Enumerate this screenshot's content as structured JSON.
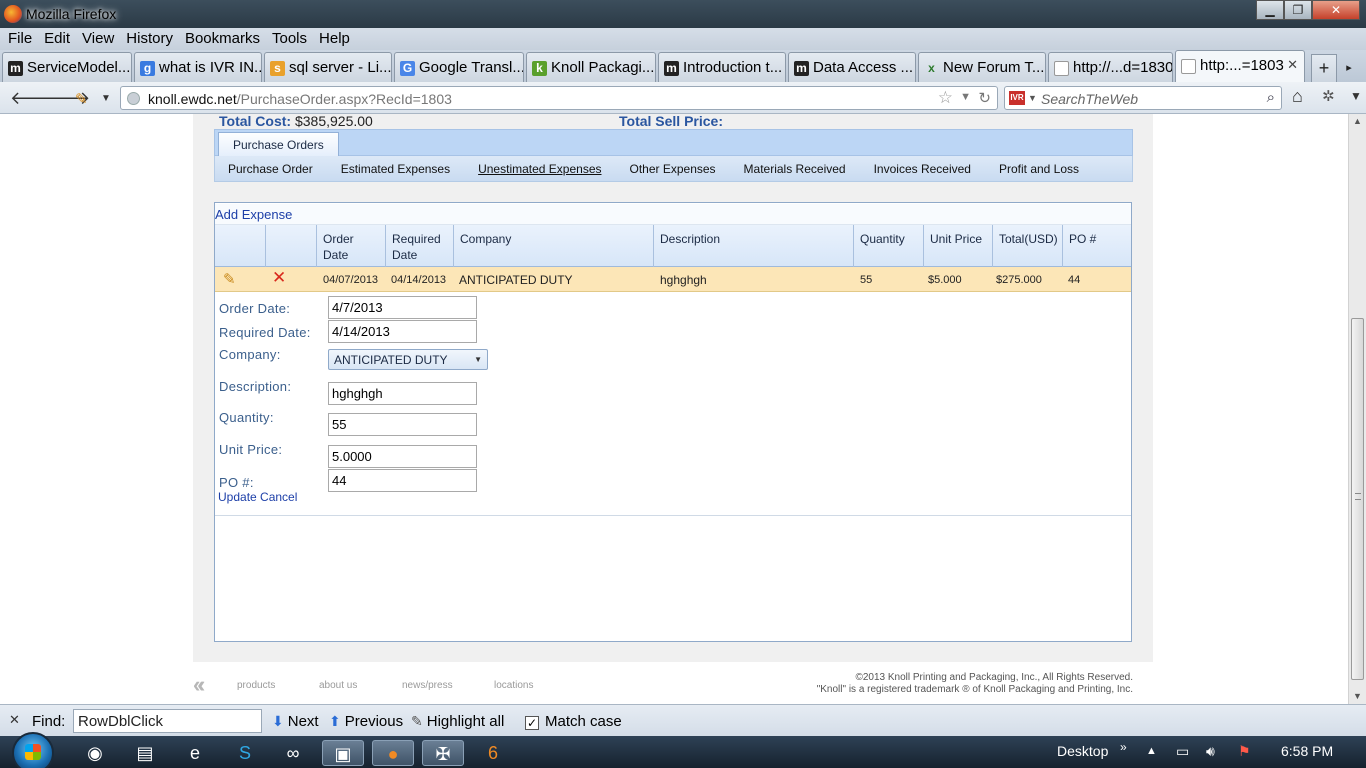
{
  "window": {
    "title": "Mozilla Firefox",
    "minimize": "▁",
    "restore": "❐",
    "close": "✕"
  },
  "menu": [
    "File",
    "Edit",
    "View",
    "History",
    "Bookmarks",
    "Tools",
    "Help"
  ],
  "tabs": [
    {
      "icon": "m",
      "label": "ServiceModel..."
    },
    {
      "icon": "g",
      "label": "what is IVR IN..."
    },
    {
      "icon": "s",
      "label": "sql server - Li..."
    },
    {
      "icon": "G",
      "label": "Google Transl..."
    },
    {
      "icon": "k",
      "label": "Knoll Packagi..."
    },
    {
      "icon": "m",
      "label": "Introduction t..."
    },
    {
      "icon": "m",
      "label": "Data Access ..."
    },
    {
      "icon": "x",
      "label": "New Forum T..."
    },
    {
      "icon": "",
      "label": "http://...d=1830"
    },
    {
      "icon": "",
      "label": "http:...=1803"
    }
  ],
  "nav": {
    "url_host": "knoll.ewdc.net",
    "url_path": "/PurchaseOrder.aspx?RecId=1803",
    "search_placeholder": "SearchTheWeb",
    "search_engine": "IVR"
  },
  "page": {
    "total_cost_label": "Total Cost:",
    "total_cost_value": "$385,925.00",
    "total_sell_label": "Total Sell Price:",
    "main_tab": "Purchase Orders",
    "subnav": [
      "Purchase Order",
      "Estimated Expenses",
      "Unestimated Expenses",
      "Other Expenses",
      "Materials Received",
      "Invoices Received",
      "Profit and Loss"
    ],
    "add_expense": "Add Expense",
    "columns": [
      "Order Date",
      "Required Date",
      "Company",
      "Description",
      "Quantity",
      "Unit Price",
      "Total(USD)",
      "PO #"
    ],
    "column_lines": [
      [
        "Order",
        "Date"
      ],
      [
        "Required",
        "Date"
      ]
    ],
    "row": {
      "order_date": "04/07/2013",
      "required_date": "04/14/2013",
      "company": "ANTICIPATED DUTY",
      "description": "hghghgh",
      "quantity": "55",
      "unit_price": "$5.000",
      "total": "$275.000",
      "po": "44"
    },
    "form": {
      "order_date_label": "Order Date:",
      "order_date": "4/7/2013",
      "required_date_label": "Required Date:",
      "required_date": "4/14/2013",
      "company_label": "Company:",
      "company": "ANTICIPATED DUTY",
      "description_label": "Description:",
      "description": "hghghgh",
      "quantity_label": "Quantity:",
      "quantity": "55",
      "unit_price_label": "Unit Price:",
      "unit_price": "5.0000",
      "po_label": "PO #:",
      "po": "44",
      "update": "Update",
      "cancel": "Cancel"
    }
  },
  "footer": {
    "links": [
      "products",
      "about us",
      "news/press",
      "locations"
    ],
    "copyright": "©2013 Knoll Printing and Packaging, Inc., All Rights Reserved.",
    "trademark": "\"Knoll\" is a registered trademark ® of Knoll Packaging and Printing, Inc."
  },
  "findbar": {
    "label": "Find:",
    "value": "RowDblClick",
    "next": "Next",
    "previous": "Previous",
    "highlight_all": "Highlight all",
    "match_case": "Match case",
    "match_case_checked": true
  },
  "taskbar": {
    "desktop": "Desktop",
    "time": "6:58 PM"
  }
}
